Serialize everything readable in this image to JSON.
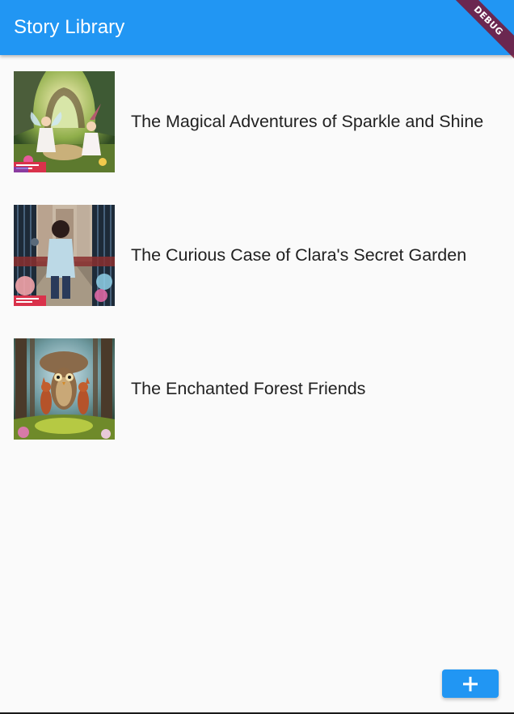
{
  "app_bar": {
    "title": "Story Library",
    "color": "#2196f3"
  },
  "debug_banner": {
    "label": "DEBUG"
  },
  "stories": [
    {
      "title": "The Magical Adventures of Sparkle and Shine",
      "cover": "fairy-forest-cover-image"
    },
    {
      "title": "The Curious Case of Clara's Secret Garden",
      "cover": "garden-gate-cover-image"
    },
    {
      "title": "The Enchanted Forest Friends",
      "cover": "forest-owl-foxes-cover-image"
    }
  ],
  "fab": {
    "icon": "plus-icon",
    "color": "#2196f3"
  }
}
